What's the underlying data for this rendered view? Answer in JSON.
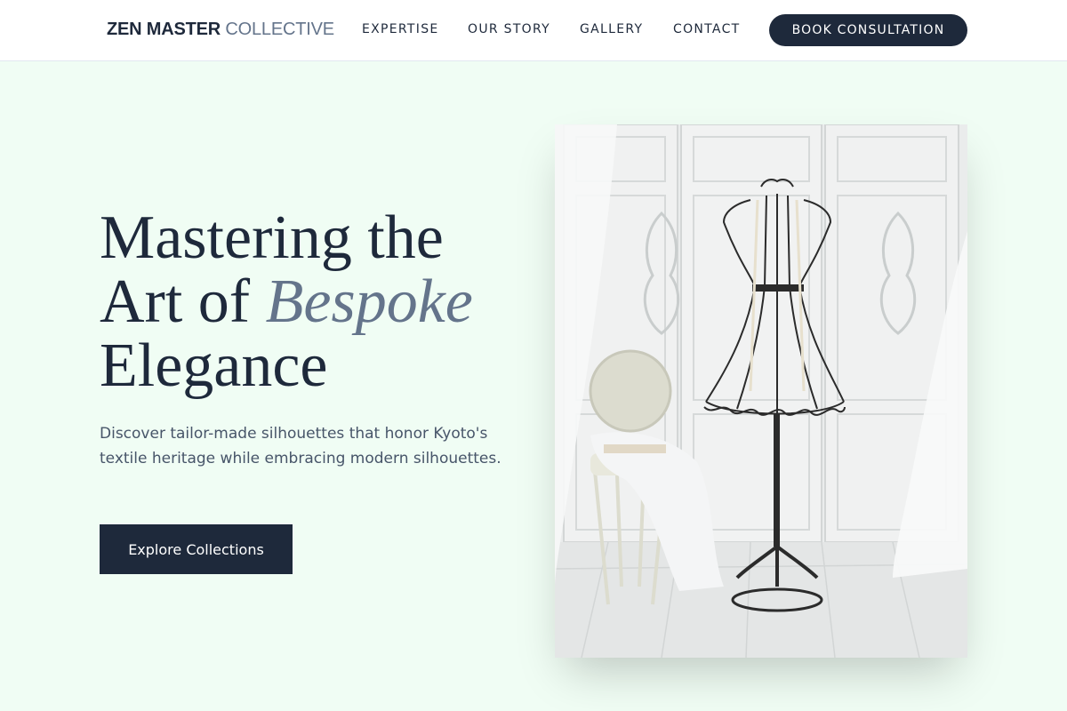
{
  "brand": {
    "strong": "ZEN MASTER",
    "light": "COLLECTIVE"
  },
  "nav": {
    "expertise": "EXPERTISE",
    "story": "OUR STORY",
    "gallery": "GALLERY",
    "contact": "CONTACT",
    "cta": "BOOK CONSULTATION"
  },
  "hero": {
    "line1": "Mastering the",
    "line2_prefix": "Art of ",
    "line2_emphasis": "Bespoke",
    "line3": "Elegance",
    "description": "Discover tailor-made silhouettes that honor Kyoto's textile heritage while embracing modern silhouettes.",
    "button": "Explore Collections"
  },
  "colors": {
    "primary": "#1e293b",
    "muted": "#64748b",
    "background": "#f0fdf4",
    "body_text": "#475569"
  },
  "icons": {
    "hero_image": "dress-form-photo"
  }
}
